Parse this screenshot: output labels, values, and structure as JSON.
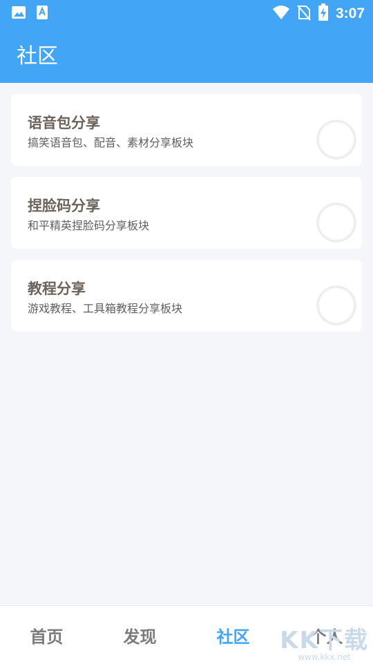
{
  "status_bar": {
    "time": "3:07",
    "icons": [
      "image-icon",
      "text-a-icon",
      "wifi-icon",
      "no-sim-icon",
      "battery-charging-icon"
    ]
  },
  "app_bar": {
    "title": "社区"
  },
  "sections": [
    {
      "title": "语音包分享",
      "subtitle": "搞笑语音包、配音、素材分享板块"
    },
    {
      "title": "捏脸码分享",
      "subtitle": "和平精英捏脸码分享板块"
    },
    {
      "title": "教程分享",
      "subtitle": "游戏教程、工具箱教程分享板块"
    }
  ],
  "bottom_nav": {
    "tabs": [
      {
        "label": "首页"
      },
      {
        "label": "发现"
      },
      {
        "label": "社区",
        "active": true
      },
      {
        "label": "个人"
      }
    ]
  },
  "watermark": {
    "main": "KK下载",
    "sub": "www.kkx.net"
  },
  "colors": {
    "primary": "#42a5f5",
    "background": "#f4f6f9",
    "card": "#ffffff",
    "tab_inactive": "#7b7b7b"
  }
}
